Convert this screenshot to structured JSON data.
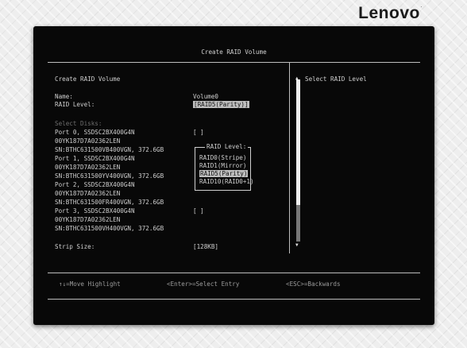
{
  "brand": {
    "logo_text": "Lenovo",
    "logo_mark": "."
  },
  "screen": {
    "title": "Create RAID Volume",
    "form_heading": "Create RAID Volume",
    "name_label": "Name:",
    "name_value": "Volume0",
    "raid_level_label": "RAID Level:",
    "raid_level_value": "[RAID5(Parity)]",
    "select_disks_label": "Select Disks:",
    "disks": [
      {
        "line1": "Port 0, SSDSC2BX400G4N",
        "line2": "00YK187D7A02362LEN",
        "line3": "SN:BTHC631500VB400VGN, 372.6GB",
        "checkbox": "[ ]"
      },
      {
        "line1": "Port 1, SSDSC2BX400G4N",
        "line2": "00YK187D7A02362LEN",
        "line3": "SN:BTHC631500YV400VGN, 372.6GB",
        "checkbox": ""
      },
      {
        "line1": "Port 2, SSDSC2BX400G4N",
        "line2": "00YK187D7A02362LEN",
        "line3": "SN:BTHC631500FR400VGN, 372.6GB",
        "checkbox": ""
      },
      {
        "line1": "Port 3, SSDSC2BX400G4N",
        "line2": "00YK187D7A02362LEN",
        "line3": "SN:BTHC631500VH400VGN, 372.6GB",
        "checkbox": "[ ]"
      }
    ],
    "strip_size_label": "Strip Size:",
    "strip_size_value": "[128KB]",
    "help_text": "Select RAID Level",
    "scroll_up": "▲",
    "scroll_down": "▼",
    "popup": {
      "title": "RAID Level:",
      "options": [
        "RAID0(Stripe)",
        "RAID1(Mirror)",
        "RAID5(Parity)",
        "RAID10(RAID0+1)"
      ],
      "selected_index": 2
    },
    "footer": {
      "move": "↑↓=Move Highlight",
      "enter": "<Enter>=Select Entry",
      "esc": "<ESC>=Backwards"
    }
  },
  "colors": {
    "screen_bg": "#080808",
    "text": "#cfcfcf",
    "highlight_bg": "#bebebe"
  }
}
